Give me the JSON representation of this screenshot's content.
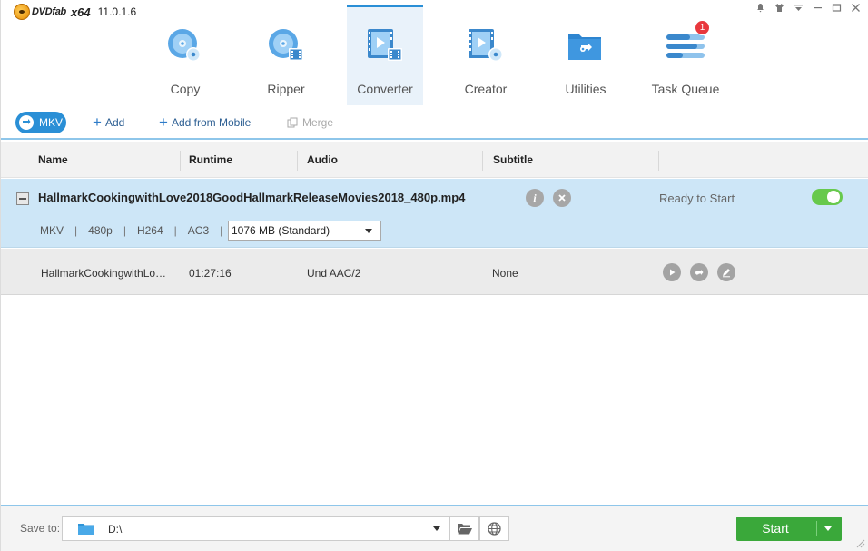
{
  "app": {
    "brand": "DVDfab",
    "arch": "x64",
    "version": "11.0.1.6"
  },
  "window_controls": [
    "notification-icon",
    "skin-icon",
    "menu-dropdown-icon",
    "minimize-icon",
    "maximize-icon",
    "close-icon"
  ],
  "tabs": [
    {
      "label": "Copy",
      "icon": "copy-disc-icon",
      "active": false
    },
    {
      "label": "Ripper",
      "icon": "ripper-disc-icon",
      "active": false
    },
    {
      "label": "Converter",
      "icon": "converter-film-icon",
      "active": true
    },
    {
      "label": "Creator",
      "icon": "creator-film-icon",
      "active": false
    },
    {
      "label": "Utilities",
      "icon": "utilities-folder-icon",
      "active": false
    },
    {
      "label": "Task Queue",
      "icon": "task-queue-icon",
      "active": false,
      "badge": "1"
    }
  ],
  "subbar": {
    "profile": "MKV",
    "add": "Add",
    "add_mobile": "Add from Mobile",
    "merge": "Merge"
  },
  "columns": {
    "name": "Name",
    "runtime": "Runtime",
    "audio": "Audio",
    "subtitle": "Subtitle"
  },
  "file": {
    "name": "HallmarkCookingwithLove2018GoodHallmarkReleaseMovies2018_480p.mp4",
    "status": "Ready to Start",
    "enabled": true,
    "format": "MKV",
    "resolution": "480p",
    "video_codec": "H264",
    "audio_codec": "AC3",
    "size_option": "1076 MB (Standard)",
    "title": {
      "name": "HallmarkCookingwithLo…",
      "runtime": "01:27:16",
      "audio": "Und AAC/2",
      "subtitle": "None"
    }
  },
  "bottom": {
    "save_label": "Save to:",
    "path": "D:\\",
    "start": "Start"
  },
  "colors": {
    "accent": "#2a8fd6",
    "selected_row": "#cde6f7",
    "start_green": "#3aa83a",
    "toggle_green": "#67c94c",
    "badge_red": "#e8383d"
  }
}
